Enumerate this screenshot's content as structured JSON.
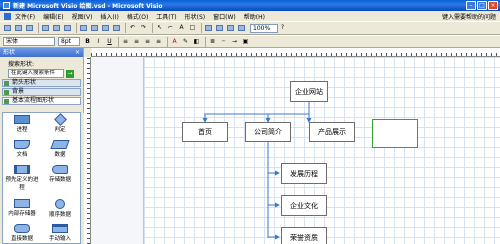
{
  "title": "新建 Microsoft Visio 绘图.vsd - Microsoft Visio",
  "menu": [
    "文件(F)",
    "编辑(E)",
    "视图(V)",
    "插入(I)",
    "格式(O)",
    "工具(T)",
    "形状(S)",
    "窗口(W)",
    "帮助(H)"
  ],
  "menu_help_hint": "键入需要帮助的问题",
  "toolbar": {
    "zoom": "100%",
    "font": "宋体",
    "font_size": "8pt",
    "bold": "B",
    "italic": "I",
    "underline": "U"
  },
  "shapes_pane": {
    "title": "形状",
    "close": "×",
    "search_label": "搜索形状:",
    "search_placeholder": "在此键入搜索条件",
    "stencils": [
      "箭头形状",
      "背景",
      "基本流程图形状"
    ],
    "masters": [
      "进程",
      "判定",
      "文档",
      "数据",
      "预先定义的进程",
      "存储数据",
      "内部存储器",
      "顺序数据",
      "直接数据",
      "手动输入"
    ]
  },
  "diagram": {
    "nodes": {
      "root": "企业网站",
      "n1": "首页",
      "n2": "公司简介",
      "n3": "产品展示",
      "c1": "发展历程",
      "c2": "企业文化",
      "c3": "荣誉资质"
    }
  },
  "colors": {
    "title_bar": "#0a5fd8",
    "selection": "#2fa52f",
    "connector": "#3c78c8"
  }
}
